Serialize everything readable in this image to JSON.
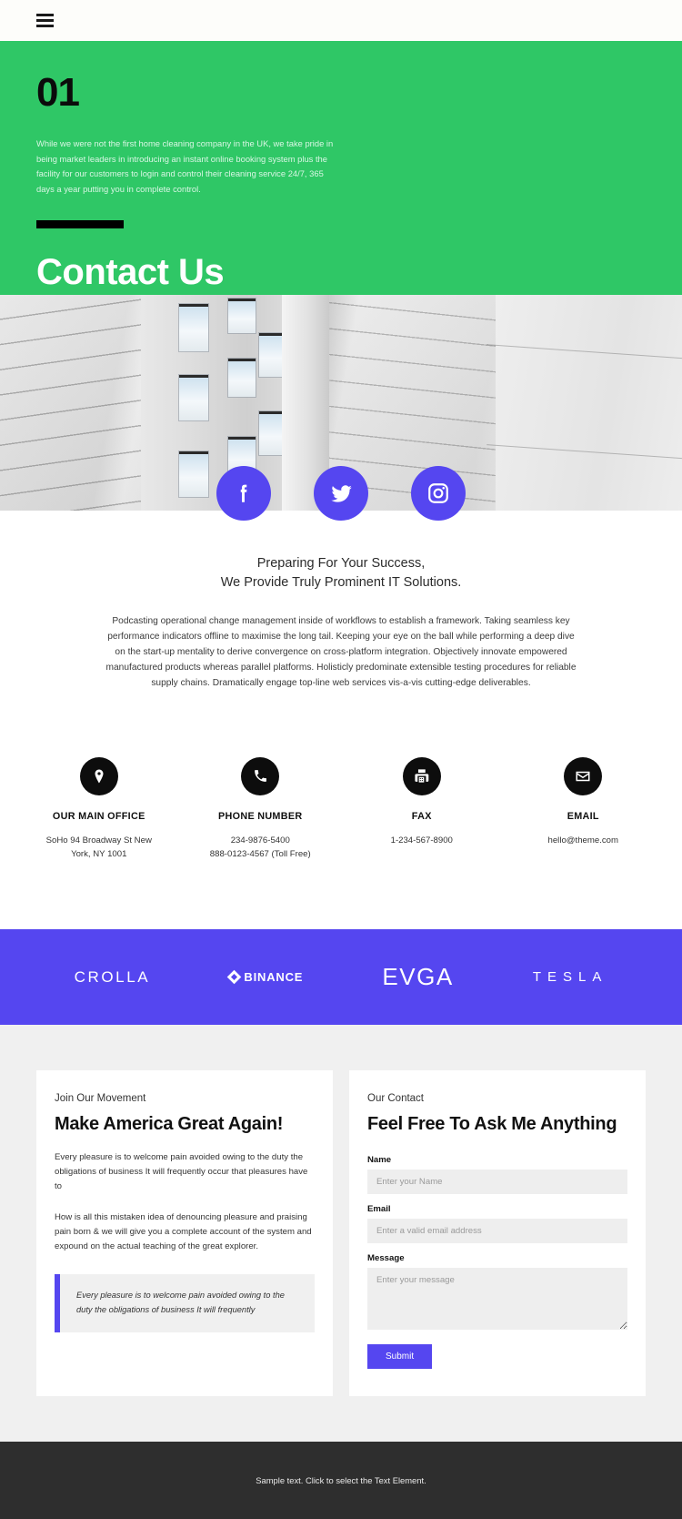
{
  "header": {
    "menu_icon": "hamburger-menu-icon"
  },
  "hero": {
    "number": "01",
    "paragraph": "While we were not the first home cleaning company in the UK, we take pride in being market leaders in introducing an instant online booking system plus the facility for our customers to login and control their cleaning service 24/7, 365 days a year putting you in complete control.",
    "title": "Contact Us",
    "bg_color": "#2fc766"
  },
  "social": {
    "accent_color": "#5546f0",
    "items": [
      {
        "icon": "facebook-icon",
        "label": "Facebook"
      },
      {
        "icon": "twitter-icon",
        "label": "Twitter"
      },
      {
        "icon": "instagram-icon",
        "label": "Instagram"
      }
    ]
  },
  "intro": {
    "heading_line1": "Preparing For Your Success,",
    "heading_line2": "We Provide Truly Prominent IT Solutions.",
    "body": "Podcasting operational change management inside of workflows to establish a framework. Taking seamless key performance indicators offline to maximise the long tail. Keeping your eye on the ball while performing a deep dive on the start-up mentality to derive convergence on cross-platform integration. Objectively innovate empowered manufactured products whereas parallel platforms. Holisticly predominate extensible testing procedures for reliable supply chains. Dramatically engage top-line web services vis-a-vis cutting-edge deliverables."
  },
  "contacts": [
    {
      "icon": "map-pin-icon",
      "title": "OUR MAIN OFFICE",
      "line1": "SoHo 94 Broadway St New",
      "line2": "York, NY 1001"
    },
    {
      "icon": "phone-icon",
      "title": "PHONE NUMBER",
      "line1": "234-9876-5400",
      "line2": "888-0123-4567 (Toll Free)"
    },
    {
      "icon": "fax-icon",
      "title": "FAX",
      "line1": "1-234-567-8900",
      "line2": ""
    },
    {
      "icon": "envelope-icon",
      "title": "EMAIL",
      "line1": "hello@theme.com",
      "line2": ""
    }
  ],
  "brands": {
    "bg_color": "#5546f0",
    "items": [
      {
        "name": "CROLLA",
        "icon": ""
      },
      {
        "name": "BINANCE",
        "icon": "binance-diamond-icon"
      },
      {
        "name": "EVGA",
        "icon": ""
      },
      {
        "name": "TESLA",
        "icon": ""
      }
    ]
  },
  "left_card": {
    "eyebrow": "Join Our Movement",
    "title": "Make America Great Again!",
    "paragraph1": "Every pleasure is to welcome pain avoided owing to the duty the obligations of business It will frequently occur that pleasures have to",
    "paragraph2": "How is all this mistaken idea of denouncing pleasure and praising pain born & we will give you a complete account of the system and expound on the actual teaching of the great explorer.",
    "quote": "Every pleasure is to welcome pain avoided owing to the duty the obligations of business It will frequently",
    "quote_accent": "#5546f0"
  },
  "form_card": {
    "eyebrow": "Our Contact",
    "title": "Feel Free To Ask Me Anything",
    "fields": [
      {
        "label": "Name",
        "placeholder": "Enter your Name",
        "value": ""
      },
      {
        "label": "Email",
        "placeholder": "Enter a valid email address",
        "value": ""
      },
      {
        "label": "Message",
        "placeholder": "Enter your message",
        "value": ""
      }
    ],
    "submit_label": "Submit",
    "submit_color": "#5546f0"
  },
  "footer": {
    "text": "Sample text. Click to select the Text Element.",
    "bg_color": "#2e2e2e"
  }
}
